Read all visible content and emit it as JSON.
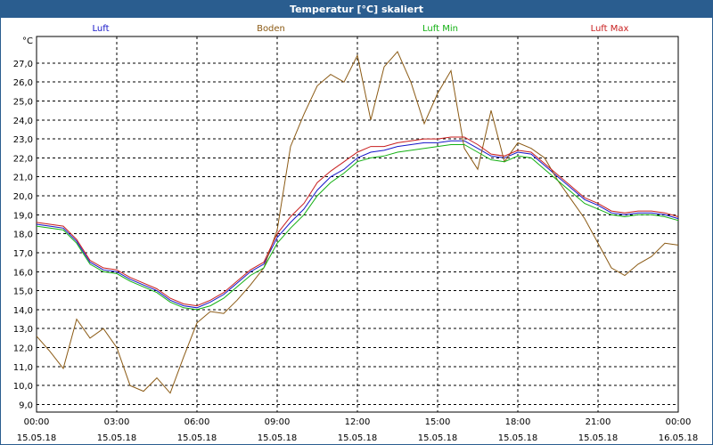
{
  "window": {
    "title": "Temperatur [°C] skaliert"
  },
  "chart_data": {
    "type": "line",
    "ylabel": "°C",
    "ylim": [
      8.6,
      28.4
    ],
    "xlim": [
      0,
      24
    ],
    "yticks": [
      "9,0",
      "10,0",
      "11,0",
      "12,0",
      "13,0",
      "14,0",
      "15,0",
      "16,0",
      "17,0",
      "18,0",
      "19,0",
      "20,0",
      "21,0",
      "22,0",
      "23,0",
      "24,0",
      "25,0",
      "26,0",
      "27,0"
    ],
    "xticks": [
      {
        "time": "00:00",
        "date": "15.05.18"
      },
      {
        "time": "03:00",
        "date": "15.05.18"
      },
      {
        "time": "06:00",
        "date": "15.05.18"
      },
      {
        "time": "09:00",
        "date": "15.05.18"
      },
      {
        "time": "12:00",
        "date": "15.05.18"
      },
      {
        "time": "15:00",
        "date": "15.05.18"
      },
      {
        "time": "18:00",
        "date": "15.05.18"
      },
      {
        "time": "21:00",
        "date": "15.05.18"
      },
      {
        "time": "00:00",
        "date": "16.05.18"
      }
    ],
    "grid": true,
    "legend": "top",
    "series": [
      {
        "name": "Luft",
        "color": "#1515c8",
        "x": [
          0,
          0.5,
          1.0,
          1.5,
          2.0,
          2.5,
          3.0,
          3.5,
          4.0,
          4.5,
          5.0,
          5.5,
          6.0,
          6.5,
          7.0,
          7.5,
          8.0,
          8.5,
          9.0,
          9.5,
          10.0,
          10.5,
          11.0,
          11.5,
          12.0,
          12.5,
          13.0,
          13.5,
          14.0,
          14.5,
          15.0,
          15.5,
          16.0,
          16.5,
          17.0,
          17.5,
          18.0,
          18.5,
          19.0,
          19.5,
          20.0,
          20.5,
          21.0,
          21.5,
          22.0,
          22.5,
          23.0,
          23.5,
          24.0
        ],
        "values": [
          18.5,
          18.4,
          18.3,
          17.6,
          16.5,
          16.1,
          16.0,
          15.6,
          15.3,
          15.0,
          14.5,
          14.2,
          14.1,
          14.4,
          14.8,
          15.4,
          16.0,
          16.4,
          17.8,
          18.6,
          19.3,
          20.3,
          21.0,
          21.4,
          22.0,
          22.3,
          22.4,
          22.6,
          22.7,
          22.8,
          22.8,
          22.9,
          22.9,
          22.5,
          22.1,
          22.0,
          22.3,
          22.2,
          21.6,
          21.0,
          20.4,
          19.8,
          19.5,
          19.1,
          19.0,
          19.1,
          19.1,
          19.0,
          18.8
        ]
      },
      {
        "name": "Boden",
        "color": "#8b5a14",
        "x": [
          0,
          0.5,
          1.0,
          1.5,
          2.0,
          2.5,
          3.0,
          3.5,
          4.0,
          4.5,
          5.0,
          5.5,
          6.0,
          6.5,
          7.0,
          7.5,
          8.0,
          8.5,
          9.0,
          9.5,
          10.0,
          10.5,
          11.0,
          11.5,
          12.0,
          12.5,
          13.0,
          13.5,
          14.0,
          14.5,
          15.0,
          15.5,
          16.0,
          16.5,
          17.0,
          17.5,
          18.0,
          18.5,
          19.0,
          19.5,
          20.0,
          20.5,
          21.0,
          21.5,
          22.0,
          22.5,
          23.0,
          23.5,
          24.0
        ],
        "values": [
          12.6,
          11.8,
          10.9,
          13.5,
          12.5,
          13.0,
          12.0,
          10.0,
          9.7,
          10.4,
          9.6,
          11.5,
          13.3,
          13.9,
          13.8,
          14.5,
          15.3,
          16.2,
          18.2,
          22.6,
          24.3,
          25.8,
          26.4,
          26.0,
          27.4,
          24.0,
          26.8,
          27.6,
          26.0,
          23.8,
          25.4,
          26.6,
          22.5,
          21.4,
          24.5,
          21.8,
          22.8,
          22.5,
          22.0,
          20.8,
          19.8,
          18.8,
          17.5,
          16.2,
          15.8,
          16.4,
          16.8,
          17.5,
          17.4
        ]
      },
      {
        "name": "Luft Min",
        "color": "#13b013",
        "x": [
          0,
          0.5,
          1.0,
          1.5,
          2.0,
          2.5,
          3.0,
          3.5,
          4.0,
          4.5,
          5.0,
          5.5,
          6.0,
          6.5,
          7.0,
          7.5,
          8.0,
          8.5,
          9.0,
          9.5,
          10.0,
          10.5,
          11.0,
          11.5,
          12.0,
          12.5,
          13.0,
          13.5,
          14.0,
          14.5,
          15.0,
          15.5,
          16.0,
          16.5,
          17.0,
          17.5,
          18.0,
          18.5,
          19.0,
          19.5,
          20.0,
          20.5,
          21.0,
          21.5,
          22.0,
          22.5,
          23.0,
          23.5,
          24.0
        ],
        "values": [
          18.4,
          18.3,
          18.2,
          17.5,
          16.4,
          16.0,
          15.9,
          15.5,
          15.2,
          14.9,
          14.4,
          14.1,
          14.0,
          14.2,
          14.6,
          15.2,
          15.8,
          16.2,
          17.5,
          18.3,
          19.0,
          20.0,
          20.7,
          21.2,
          21.8,
          22.0,
          22.1,
          22.3,
          22.4,
          22.5,
          22.6,
          22.7,
          22.7,
          22.3,
          21.9,
          21.8,
          22.1,
          22.0,
          21.4,
          20.8,
          20.2,
          19.6,
          19.3,
          19.0,
          18.9,
          19.0,
          19.0,
          18.9,
          18.7
        ]
      },
      {
        "name": "Luft Max",
        "color": "#c81e1e",
        "x": [
          0,
          0.5,
          1.0,
          1.5,
          2.0,
          2.5,
          3.0,
          3.5,
          4.0,
          4.5,
          5.0,
          5.5,
          6.0,
          6.5,
          7.0,
          7.5,
          8.0,
          8.5,
          9.0,
          9.5,
          10.0,
          10.5,
          11.0,
          11.5,
          12.0,
          12.5,
          13.0,
          13.5,
          14.0,
          14.5,
          15.0,
          15.5,
          16.0,
          16.5,
          17.0,
          17.5,
          18.0,
          18.5,
          19.0,
          19.5,
          20.0,
          20.5,
          21.0,
          21.5,
          22.0,
          22.5,
          23.0,
          23.5,
          24.0
        ],
        "values": [
          18.6,
          18.5,
          18.4,
          17.7,
          16.6,
          16.2,
          16.1,
          15.7,
          15.4,
          15.1,
          14.6,
          14.3,
          14.2,
          14.5,
          14.9,
          15.5,
          16.1,
          16.5,
          18.0,
          18.9,
          19.6,
          20.7,
          21.3,
          21.8,
          22.3,
          22.6,
          22.6,
          22.8,
          22.9,
          23.0,
          23.0,
          23.1,
          23.1,
          22.7,
          22.2,
          22.1,
          22.4,
          22.3,
          21.7,
          21.1,
          20.5,
          19.9,
          19.6,
          19.2,
          19.1,
          19.2,
          19.2,
          19.1,
          18.9
        ]
      }
    ]
  }
}
